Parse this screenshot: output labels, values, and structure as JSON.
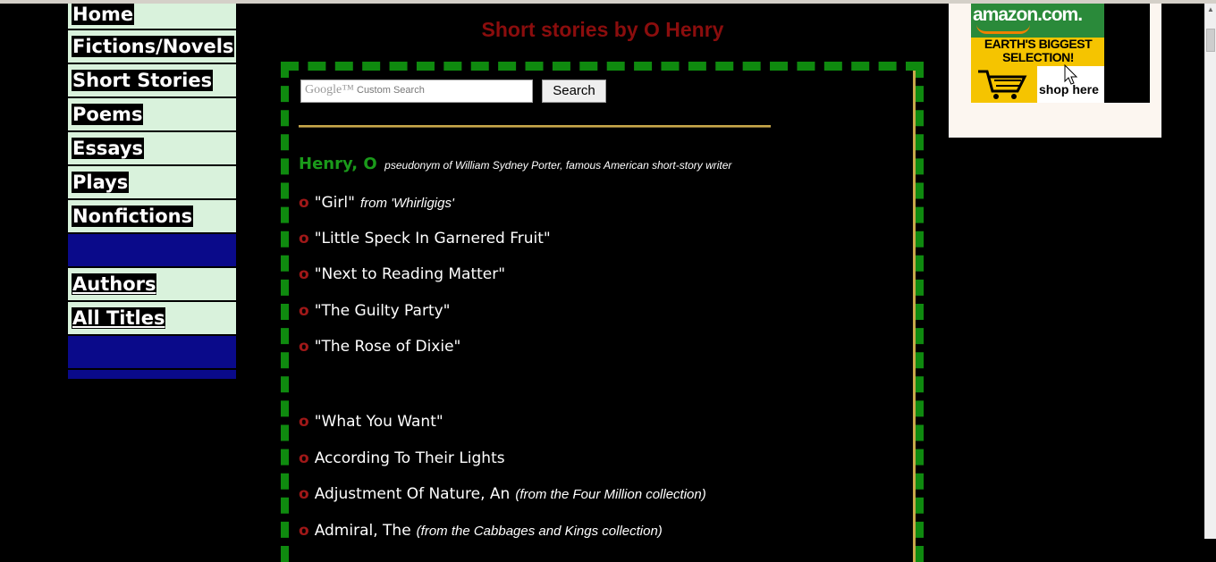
{
  "nav": {
    "items": [
      {
        "label": "Home",
        "underline": false
      },
      {
        "label": "Fictions/Novels",
        "underline": false
      },
      {
        "label": "Short Stories",
        "underline": false
      },
      {
        "label": "Poems",
        "underline": false
      },
      {
        "label": "Essays",
        "underline": false
      },
      {
        "label": "Plays",
        "underline": false
      },
      {
        "label": "Nonfictions",
        "underline": false
      },
      {
        "label": "Authors",
        "underline": true
      },
      {
        "label": "All Titles",
        "underline": true
      }
    ]
  },
  "page": {
    "title": "Short stories by O Henry"
  },
  "search": {
    "placeholder": "Custom Search",
    "brand": "Google™",
    "button_label": "Search"
  },
  "author": {
    "name": "Henry, O",
    "description": "pseudonym of William Sydney Porter, famous American short-story writer"
  },
  "bullet_glyph": "o",
  "stories": [
    {
      "title": "\"Girl\"",
      "note": "from 'Whirligigs'"
    },
    {
      "title": "\"Little Speck In Garnered Fruit\"",
      "note": ""
    },
    {
      "title": "\"Next to Reading Matter\"",
      "note": ""
    },
    {
      "title": "\"The Guilty Party\"",
      "note": ""
    },
    {
      "title": "\"The Rose of Dixie\"",
      "note": ""
    },
    {
      "title": "\"What You Want\"",
      "note": ""
    },
    {
      "title": "According To Their Lights",
      "note": ""
    },
    {
      "title": "Adjustment Of Nature, An",
      "note": "(from the Four Million collection)"
    },
    {
      "title": "Admiral, The",
      "note": "(from the Cabbages and Kings collection)"
    }
  ],
  "ad": {
    "logo": "amazon.com.",
    "headline": "EARTH'S BIGGEST SELECTION!",
    "cta": "shop here"
  },
  "colors": {
    "nav_bg": "#d9f2dc",
    "nav_blue": "#0a0a8a",
    "title_red": "#8b0d0d",
    "border_green": "#0f8a0f",
    "author_green": "#1a9a1a",
    "bullet_red": "#a01818"
  }
}
